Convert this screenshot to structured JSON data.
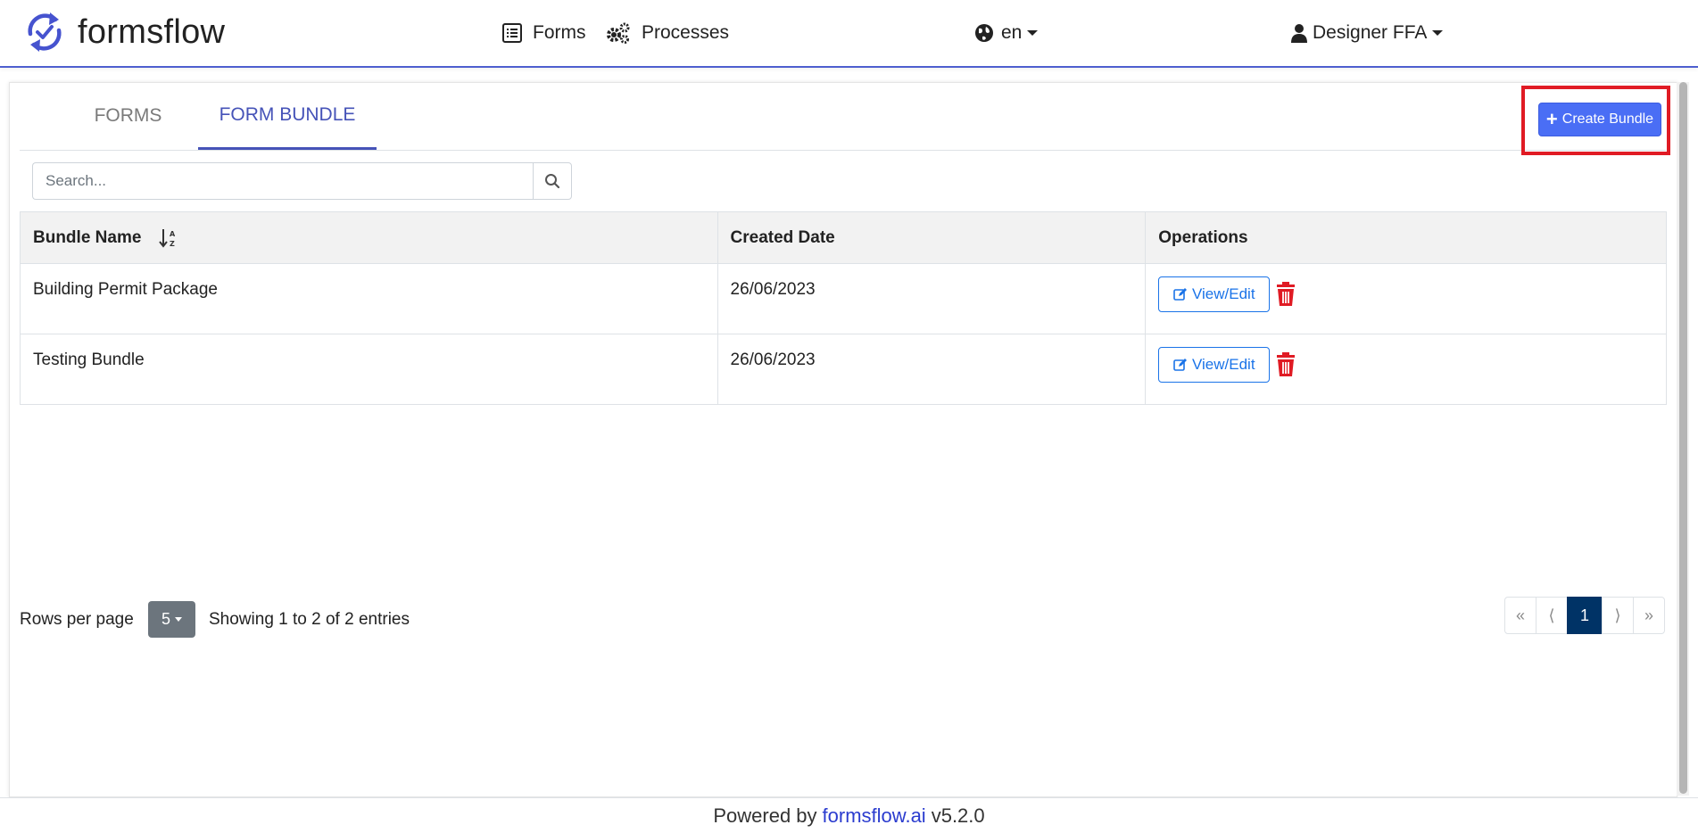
{
  "brand": {
    "name": "formsflow"
  },
  "nav": {
    "forms_label": "Forms",
    "processes_label": "Processes",
    "language": "en",
    "user": "Designer FFA"
  },
  "tabs": [
    {
      "label": "FORMS",
      "active": false
    },
    {
      "label": "FORM BUNDLE",
      "active": true
    }
  ],
  "create_button": {
    "label": "Create Bundle"
  },
  "search": {
    "placeholder": "Search..."
  },
  "table": {
    "headers": {
      "name": "Bundle Name",
      "date": "Created Date",
      "ops": "Operations"
    },
    "rows": [
      {
        "name": "Building Permit Package",
        "date": "26/06/2023",
        "action": "View/Edit"
      },
      {
        "name": "Testing Bundle",
        "date": "26/06/2023",
        "action": "View/Edit"
      }
    ]
  },
  "pagination": {
    "rows_label": "Rows per page",
    "rows_per_page": "5",
    "showing": "Showing 1 to 2 of 2 entries",
    "first": "«",
    "prev": "⟨",
    "current": "1",
    "next": "⟩",
    "last": "»"
  },
  "footer": {
    "prefix": "Powered by",
    "link": "formsflow.ai",
    "version": "v5.2.0"
  },
  "colors": {
    "accent": "#4653b8",
    "primary_button": "#4a6ef5",
    "delete": "#e01b24",
    "active_page": "#003366"
  }
}
